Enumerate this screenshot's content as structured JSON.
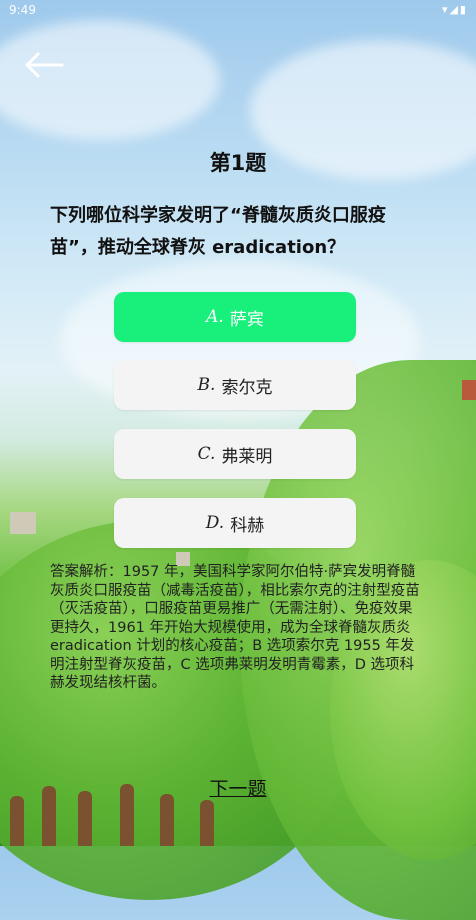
{
  "status_bar": {
    "time": "9:49",
    "icons": "▾◢▮"
  },
  "header": {
    "back_icon": "arrow-left-icon"
  },
  "quiz": {
    "title": "第1题",
    "question": "下列哪位科学家发明了“脊髓灰质炎口服疫苗”，推动全球脊灰 eradication？",
    "options": [
      {
        "letter": "A.",
        "text": "萨宾",
        "state": "correct"
      },
      {
        "letter": "B.",
        "text": "索尔克",
        "state": "normal"
      },
      {
        "letter": "C.",
        "text": "弗莱明",
        "state": "normal"
      },
      {
        "letter": "D.",
        "text": "科赫",
        "state": "normal"
      }
    ],
    "analysis": "答案解析：1957 年，美国科学家阿尔伯特·萨宾发明脊髓灰质炎口服疫苗（减毒活疫苗），相比索尔克的注射型疫苗（灭活疫苗），口服疫苗更易推广（无需注射）、免疫效果更持久，1961 年开始大规模使用，成为全球脊髓灰质炎 eradication 计划的核心疫苗；B 选项索尔克 1955 年发明注射型脊灰疫苗，C 选项弗莱明发明青霉素，D 选项科赫发现结核杆菌。",
    "next_label": "下一题"
  },
  "colors": {
    "correct_option": "#19f07c",
    "option_bg": "#f4f4f4"
  }
}
